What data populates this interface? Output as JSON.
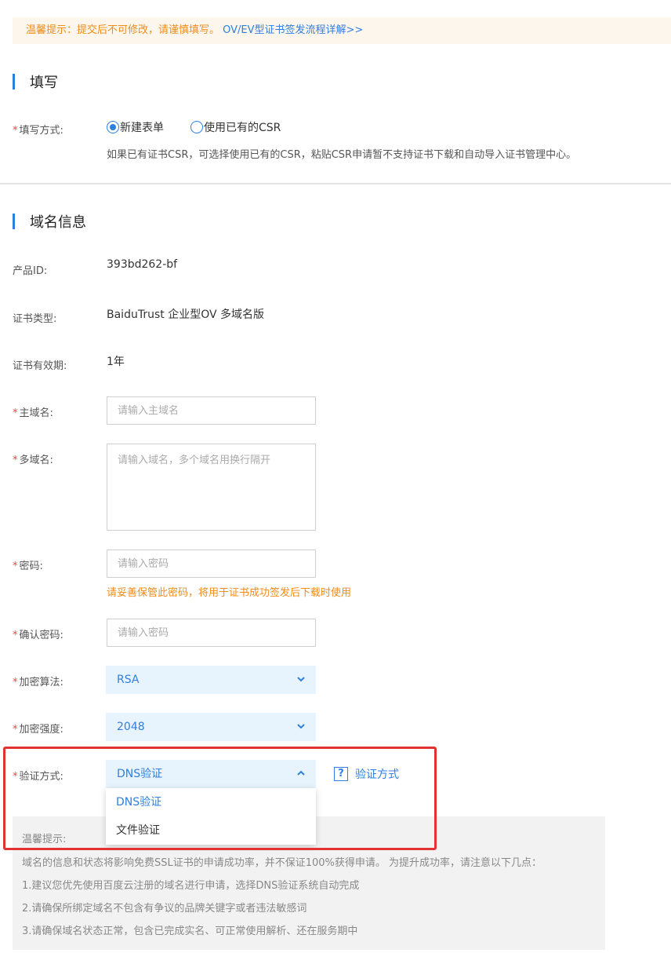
{
  "notice": {
    "text": "温馨提示：提交后不可修改，请谨慎填写。",
    "link": "OV/EV型证书签发流程详解>>"
  },
  "section_fill": {
    "title": "填写",
    "method_label": "填写方式:",
    "options": [
      "新建表单",
      "使用已有的CSR"
    ],
    "selected": "新建表单",
    "hint": "如果已有证书CSR，可选择使用已有的CSR，粘贴CSR申请暂不支持证书下载和自动导入证书管理中心。"
  },
  "section_domain": {
    "title": "域名信息",
    "product_id_label": "产品ID:",
    "product_id": "393bd262-bf",
    "cert_type_label": "证书类型:",
    "cert_type": "BaiduTrust 企业型OV 多域名版",
    "validity_label": "证书有效期:",
    "validity": "1年",
    "main_domain_label": "主域名:",
    "main_domain_placeholder": "请输入主域名",
    "multi_domain_label": "多域名:",
    "multi_domain_placeholder": "请输入域名，多个域名用换行隔开",
    "password_label": "密码:",
    "password_placeholder": "请输入密码",
    "password_warning": "请妥善保管此密码，将用于证书成功签发后下载时使用",
    "confirm_label": "确认密码:",
    "confirm_placeholder": "请输入密码",
    "algorithm_label": "加密算法:",
    "algorithm": "RSA",
    "strength_label": "加密强度:",
    "strength": "2048",
    "verify_label": "验证方式:",
    "verify": "DNS验证",
    "verify_options": [
      "DNS验证",
      "文件验证"
    ],
    "help_icon": "?",
    "help_link": "验证方式"
  },
  "tips": {
    "title": "温馨提示:",
    "lines": [
      "域名的信息和状态将影响免费SSL证书的申请成功率，并不保证100%获得申请。 为提升成功率，请注意以下几点：",
      "1.建议您优先使用百度云注册的域名进行申请，选择DNS验证系统自动完成",
      "2.请确保所绑定域名不包含有争议的品牌关键字或者违法敏感词",
      "3.请确保域名状态正常，包含已完成实名、可正常使用解析、还在服务期中"
    ]
  },
  "required_mark": "*",
  "colors": {
    "accent": "#2f7fe0",
    "warning": "#f08c1a",
    "required": "#e64545",
    "highlight": "#e23232"
  }
}
